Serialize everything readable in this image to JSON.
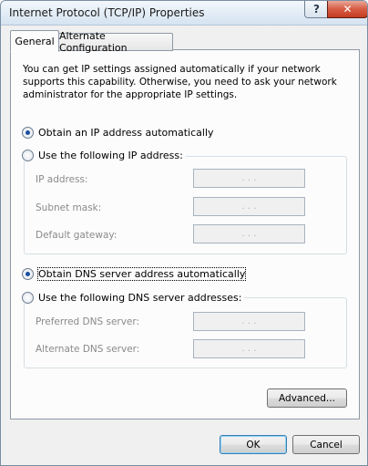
{
  "window": {
    "title": "Internet Protocol (TCP/IP) Properties",
    "help_label": "?",
    "close_label": "✕"
  },
  "tabs": [
    {
      "label": "General",
      "active": true
    },
    {
      "label": "Alternate Configuration",
      "active": false
    }
  ],
  "general": {
    "description": "You can get IP settings assigned automatically if your network supports this capability. Otherwise, you need to ask your network administrator for the appropriate IP settings.",
    "ip": {
      "auto": {
        "label": "Obtain an IP address automatically",
        "checked": true
      },
      "manual": {
        "label": "Use the following IP address:",
        "checked": false
      },
      "fields": [
        {
          "label": "IP address:",
          "value": ". . ."
        },
        {
          "label": "Subnet mask:",
          "value": ". . ."
        },
        {
          "label": "Default gateway:",
          "value": ". . ."
        }
      ]
    },
    "dns": {
      "auto": {
        "label": "Obtain DNS server address automatically",
        "checked": true
      },
      "manual": {
        "label": "Use the following DNS server addresses:",
        "checked": false
      },
      "fields": [
        {
          "label": "Preferred DNS server:",
          "value": ". . ."
        },
        {
          "label": "Alternate DNS server:",
          "value": ". . ."
        }
      ]
    },
    "advanced_label": "Advanced..."
  },
  "footer": {
    "ok_label": "OK",
    "cancel_label": "Cancel"
  }
}
